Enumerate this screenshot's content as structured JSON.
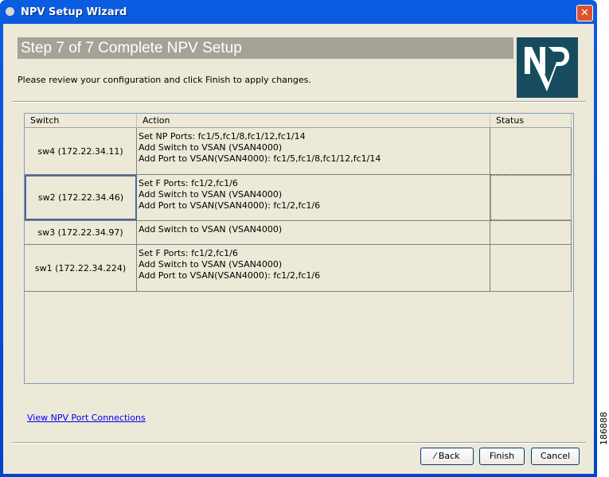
{
  "window": {
    "title": "NPV Setup Wizard"
  },
  "header": {
    "title": "Step 7 of 7 Complete NPV Setup",
    "logo_text": "NPV",
    "instruction": "Please review your configuration and click Finish to apply changes."
  },
  "table": {
    "columns": [
      "Switch",
      "Action",
      "Status"
    ],
    "rows": [
      {
        "switch": "sw4 (172.22.34.11)",
        "actions": [
          "Set NP Ports: fc1/5,fc1/8,fc1/12,fc1/14",
          "Add Switch to VSAN (VSAN4000)",
          "Add Port to VSAN(VSAN4000): fc1/5,fc1/8,fc1/12,fc1/14"
        ],
        "status": ""
      },
      {
        "switch": "sw2 (172.22.34.46)",
        "actions": [
          "Set F Ports: fc1/2,fc1/6",
          "Add Switch to VSAN (VSAN4000)",
          "Add Port to VSAN(VSAN4000): fc1/2,fc1/6"
        ],
        "status": ""
      },
      {
        "switch": "sw3 (172.22.34.97)",
        "actions": [
          "Add Switch to VSAN (VSAN4000)"
        ],
        "status": ""
      },
      {
        "switch": "sw1 (172.22.34.224)",
        "actions": [
          "Set F Ports: fc1/2,fc1/6",
          "Add Switch to VSAN (VSAN4000)",
          "Add Port to VSAN(VSAN4000): fc1/2,fc1/6"
        ],
        "status": ""
      }
    ]
  },
  "link": "View NPV Port Connections",
  "buttons": {
    "back": "Back",
    "finish": "Finish",
    "cancel": "Cancel"
  },
  "watermark": "186888"
}
